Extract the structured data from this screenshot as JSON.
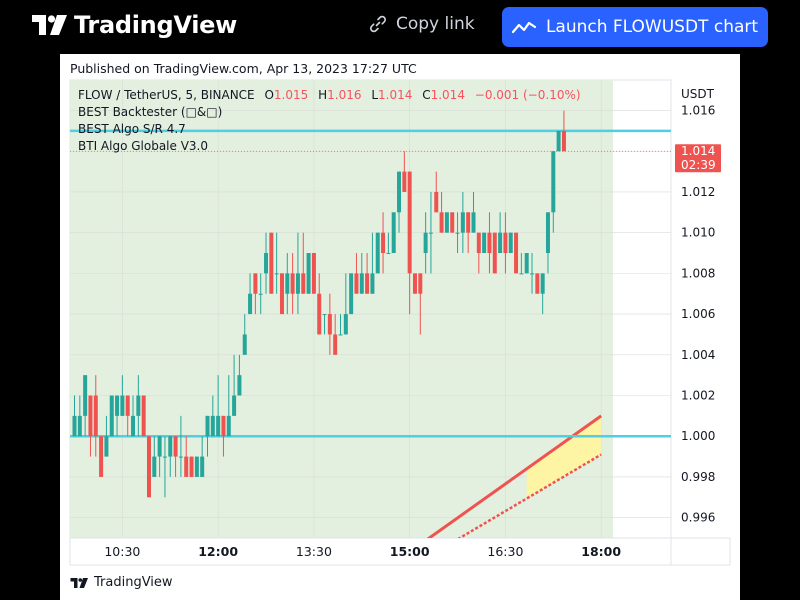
{
  "header": {
    "brand": "TradingView",
    "copy_link": "Copy link",
    "launch_button": "Launch FLOWUSDT chart",
    "brand_color": "#2962ff"
  },
  "published": "Published on TradingView.com, Apr 13, 2023 17:27 UTC",
  "legend": {
    "symbol": "FLOW / TetherUS, 5, BINANCE",
    "open_label": "O",
    "open": "1.015",
    "high_label": "H",
    "high": "1.016",
    "low_label": "L",
    "low": "1.014",
    "close_label": "C",
    "close": "1.014",
    "change": "−0.001 (−0.10%)",
    "indicators": [
      "BEST Backtester (□&□)",
      "BEST Algo S/R 4.7",
      "BTI Algo Globale V3.0"
    ]
  },
  "price_badge": {
    "price": "1.014",
    "countdown": "02:39"
  },
  "footer_brand": "TradingView",
  "chart_data": {
    "type": "candlestick",
    "interval_minutes": 5,
    "start_time": "09:45",
    "y_axis_label": "USDT",
    "ylim": [
      0.995,
      1.0175
    ],
    "y_ticks": [
      "1.016",
      "1.014",
      "1.012",
      "1.010",
      "1.008",
      "1.006",
      "1.004",
      "1.002",
      "1.000",
      "0.998",
      "0.996"
    ],
    "x_ticks": [
      {
        "label": "10:30",
        "bold": false
      },
      {
        "label": "12:00",
        "bold": true
      },
      {
        "label": "13:30",
        "bold": false
      },
      {
        "label": "15:00",
        "bold": true
      },
      {
        "label": "16:30",
        "bold": false
      },
      {
        "label": "18:00",
        "bold": true
      }
    ],
    "colors": {
      "up": "#26a69a",
      "down": "#ef5350",
      "sr_line": "#4dd0e1",
      "band_fill": "#fff59d",
      "band_edge": "#ef5350",
      "session_bg": "#e3efdf"
    },
    "candles": [
      {
        "o": 1.0,
        "h": 1.002,
        "l": 1.0,
        "c": 1.001
      },
      {
        "o": 1.0,
        "h": 1.002,
        "l": 1.0,
        "c": 1.001
      },
      {
        "o": 1.001,
        "h": 1.003,
        "l": 1.0,
        "c": 1.003
      },
      {
        "o": 1.002,
        "h": 1.002,
        "l": 0.999,
        "c": 1.0
      },
      {
        "o": 1.002,
        "h": 1.003,
        "l": 0.999,
        "c": 1.0
      },
      {
        "o": 1.0,
        "h": 1.0,
        "l": 0.998,
        "c": 0.998
      },
      {
        "o": 0.999,
        "h": 1.001,
        "l": 0.999,
        "c": 1.0
      },
      {
        "o": 1.0,
        "h": 1.002,
        "l": 1.0,
        "c": 1.002
      },
      {
        "o": 1.001,
        "h": 1.002,
        "l": 1.0,
        "c": 1.002
      },
      {
        "o": 1.001,
        "h": 1.003,
        "l": 1.001,
        "c": 1.002
      },
      {
        "o": 1.002,
        "h": 1.002,
        "l": 1.0,
        "c": 1.001
      },
      {
        "o": 1.0,
        "h": 1.002,
        "l": 1.0,
        "c": 1.001
      },
      {
        "o": 1.001,
        "h": 1.003,
        "l": 1.0,
        "c": 1.002
      },
      {
        "o": 1.002,
        "h": 1.002,
        "l": 1.0,
        "c": 1.0
      },
      {
        "o": 1.0,
        "h": 1.0,
        "l": 0.997,
        "c": 0.997
      },
      {
        "o": 0.998,
        "h": 1.0,
        "l": 0.998,
        "c": 0.999
      },
      {
        "o": 0.999,
        "h": 1.0,
        "l": 0.998,
        "c": 1.0
      },
      {
        "o": 0.999,
        "h": 1.0,
        "l": 0.997,
        "c": 0.999
      },
      {
        "o": 0.999,
        "h": 1.0,
        "l": 0.998,
        "c": 1.0
      },
      {
        "o": 1.0,
        "h": 1.0,
        "l": 0.998,
        "c": 0.999
      },
      {
        "o": 0.999,
        "h": 1.001,
        "l": 0.998,
        "c": 0.999
      },
      {
        "o": 0.999,
        "h": 1.0,
        "l": 0.998,
        "c": 0.998
      },
      {
        "o": 0.999,
        "h": 0.999,
        "l": 0.998,
        "c": 0.998
      },
      {
        "o": 0.998,
        "h": 0.999,
        "l": 0.998,
        "c": 0.999
      },
      {
        "o": 0.998,
        "h": 1.0,
        "l": 0.998,
        "c": 0.999
      },
      {
        "o": 1.0,
        "h": 1.001,
        "l": 0.999,
        "c": 1.001
      },
      {
        "o": 1.0,
        "h": 1.002,
        "l": 1.0,
        "c": 1.001
      },
      {
        "o": 1.0,
        "h": 1.003,
        "l": 1.0,
        "c": 1.001
      },
      {
        "o": 1.001,
        "h": 1.001,
        "l": 0.999,
        "c": 1.0
      },
      {
        "o": 1.0,
        "h": 1.003,
        "l": 1.0,
        "c": 1.001
      },
      {
        "o": 1.001,
        "h": 1.004,
        "l": 1.001,
        "c": 1.002
      },
      {
        "o": 1.002,
        "h": 1.004,
        "l": 1.002,
        "c": 1.003
      },
      {
        "o": 1.004,
        "h": 1.006,
        "l": 1.004,
        "c": 1.005
      },
      {
        "o": 1.006,
        "h": 1.008,
        "l": 1.006,
        "c": 1.007
      },
      {
        "o": 1.008,
        "h": 1.008,
        "l": 1.006,
        "c": 1.007
      },
      {
        "o": 1.007,
        "h": 1.008,
        "l": 1.006,
        "c": 1.007
      },
      {
        "o": 1.008,
        "h": 1.01,
        "l": 1.007,
        "c": 1.009
      },
      {
        "o": 1.01,
        "h": 1.01,
        "l": 1.007,
        "c": 1.007
      },
      {
        "o": 1.008,
        "h": 1.01,
        "l": 1.007,
        "c": 1.008
      },
      {
        "o": 1.008,
        "h": 1.008,
        "l": 1.006,
        "c": 1.006
      },
      {
        "o": 1.007,
        "h": 1.009,
        "l": 1.006,
        "c": 1.008
      },
      {
        "o": 1.008,
        "h": 1.009,
        "l": 1.006,
        "c": 1.007
      },
      {
        "o": 1.007,
        "h": 1.01,
        "l": 1.006,
        "c": 1.008
      },
      {
        "o": 1.008,
        "h": 1.01,
        "l": 1.007,
        "c": 1.007
      },
      {
        "o": 1.007,
        "h": 1.009,
        "l": 1.007,
        "c": 1.009
      },
      {
        "o": 1.009,
        "h": 1.009,
        "l": 1.007,
        "c": 1.007
      },
      {
        "o": 1.007,
        "h": 1.008,
        "l": 1.005,
        "c": 1.005
      },
      {
        "o": 1.006,
        "h": 1.006,
        "l": 1.005,
        "c": 1.006
      },
      {
        "o": 1.006,
        "h": 1.007,
        "l": 1.004,
        "c": 1.005
      },
      {
        "o": 1.005,
        "h": 1.006,
        "l": 1.004,
        "c": 1.004
      },
      {
        "o": 1.005,
        "h": 1.006,
        "l": 1.005,
        "c": 1.005
      },
      {
        "o": 1.005,
        "h": 1.008,
        "l": 1.005,
        "c": 1.006
      },
      {
        "o": 1.006,
        "h": 1.008,
        "l": 1.006,
        "c": 1.008
      },
      {
        "o": 1.008,
        "h": 1.009,
        "l": 1.007,
        "c": 1.007
      },
      {
        "o": 1.007,
        "h": 1.009,
        "l": 1.007,
        "c": 1.008
      },
      {
        "o": 1.008,
        "h": 1.009,
        "l": 1.007,
        "c": 1.007
      },
      {
        "o": 1.007,
        "h": 1.01,
        "l": 1.007,
        "c": 1.008
      },
      {
        "o": 1.008,
        "h": 1.01,
        "l": 1.008,
        "c": 1.01
      },
      {
        "o": 1.01,
        "h": 1.011,
        "l": 1.008,
        "c": 1.009
      },
      {
        "o": 1.009,
        "h": 1.01,
        "l": 1.009,
        "c": 1.009
      },
      {
        "o": 1.009,
        "h": 1.011,
        "l": 1.009,
        "c": 1.011
      },
      {
        "o": 1.011,
        "h": 1.013,
        "l": 1.01,
        "c": 1.013
      },
      {
        "o": 1.013,
        "h": 1.014,
        "l": 1.012,
        "c": 1.012
      },
      {
        "o": 1.013,
        "h": 1.013,
        "l": 1.006,
        "c": 1.008
      },
      {
        "o": 1.008,
        "h": 1.008,
        "l": 1.007,
        "c": 1.007
      },
      {
        "o": 1.008,
        "h": 1.008,
        "l": 1.005,
        "c": 1.007
      },
      {
        "o": 1.009,
        "h": 1.011,
        "l": 1.008,
        "c": 1.01
      },
      {
        "o": 1.01,
        "h": 1.012,
        "l": 1.008,
        "c": 1.01
      },
      {
        "o": 1.012,
        "h": 1.013,
        "l": 1.011,
        "c": 1.011
      },
      {
        "o": 1.011,
        "h": 1.012,
        "l": 1.01,
        "c": 1.01
      },
      {
        "o": 1.01,
        "h": 1.011,
        "l": 1.01,
        "c": 1.011
      },
      {
        "o": 1.011,
        "h": 1.011,
        "l": 1.01,
        "c": 1.01
      },
      {
        "o": 1.01,
        "h": 1.011,
        "l": 1.009,
        "c": 1.01
      },
      {
        "o": 1.01,
        "h": 1.012,
        "l": 1.009,
        "c": 1.011
      },
      {
        "o": 1.011,
        "h": 1.011,
        "l": 1.009,
        "c": 1.01
      },
      {
        "o": 1.01,
        "h": 1.012,
        "l": 1.01,
        "c": 1.011
      },
      {
        "o": 1.01,
        "h": 1.01,
        "l": 1.008,
        "c": 1.009
      },
      {
        "o": 1.009,
        "h": 1.01,
        "l": 1.009,
        "c": 1.01
      },
      {
        "o": 1.01,
        "h": 1.011,
        "l": 1.008,
        "c": 1.009
      },
      {
        "o": 1.01,
        "h": 1.01,
        "l": 1.008,
        "c": 1.008
      },
      {
        "o": 1.009,
        "h": 1.011,
        "l": 1.009,
        "c": 1.01
      },
      {
        "o": 1.01,
        "h": 1.011,
        "l": 1.008,
        "c": 1.009
      },
      {
        "o": 1.009,
        "h": 1.01,
        "l": 1.009,
        "c": 1.01
      },
      {
        "o": 1.01,
        "h": 1.01,
        "l": 1.008,
        "c": 1.008
      },
      {
        "o": 1.008,
        "h": 1.009,
        "l": 1.008,
        "c": 1.008
      },
      {
        "o": 1.008,
        "h": 1.009,
        "l": 1.008,
        "c": 1.009
      },
      {
        "o": 1.008,
        "h": 1.009,
        "l": 1.007,
        "c": 1.008
      },
      {
        "o": 1.008,
        "h": 1.008,
        "l": 1.007,
        "c": 1.007
      },
      {
        "o": 1.007,
        "h": 1.008,
        "l": 1.006,
        "c": 1.008
      },
      {
        "o": 1.009,
        "h": 1.011,
        "l": 1.008,
        "c": 1.011
      },
      {
        "o": 1.011,
        "h": 1.014,
        "l": 1.01,
        "c": 1.014
      },
      {
        "o": 1.014,
        "h": 1.015,
        "l": 1.014,
        "c": 1.015
      },
      {
        "o": 1.015,
        "h": 1.016,
        "l": 1.014,
        "c": 1.014
      }
    ],
    "support_resistance": [
      1.015,
      1.0
    ],
    "last_price": 1.014,
    "trend_band": {
      "upper": [
        [
          64,
          0.9945
        ],
        [
          99,
          1.001
        ]
      ],
      "lower": [
        [
          64,
          0.9937
        ],
        [
          99,
          0.9991
        ]
      ],
      "band_start_index": 85
    }
  }
}
